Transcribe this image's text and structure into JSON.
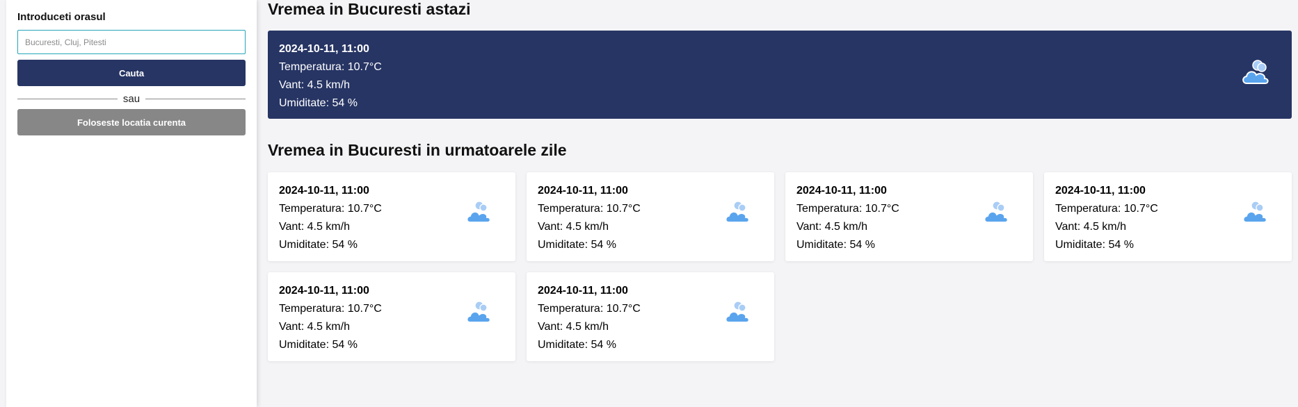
{
  "sidebar": {
    "title": "Introduceti orasul",
    "input_placeholder": "Bucuresti, Cluj, Pitesti",
    "input_value": "",
    "search_label": "Cauta",
    "divider_label": "sau",
    "location_label": "Foloseste locatia curenta"
  },
  "today": {
    "title": "Vremea in Bucuresti astazi",
    "date": "2024-10-11, 11:00",
    "temperature": "Temperatura: 10.7°C",
    "wind": "Vant: 4.5 km/h",
    "humidity": "Umiditate: 54 %",
    "icon": "cloudy-icon"
  },
  "forecast": {
    "title": "Vremea in Bucuresti in urmatoarele zile",
    "items": [
      {
        "date": "2024-10-11, 11:00",
        "temperature": "Temperatura: 10.7°C",
        "wind": "Vant: 4.5 km/h",
        "humidity": "Umiditate: 54 %",
        "icon": "cloudy-icon"
      },
      {
        "date": "2024-10-11, 11:00",
        "temperature": "Temperatura: 10.7°C",
        "wind": "Vant: 4.5 km/h",
        "humidity": "Umiditate: 54 %",
        "icon": "cloudy-icon"
      },
      {
        "date": "2024-10-11, 11:00",
        "temperature": "Temperatura: 10.7°C",
        "wind": "Vant: 4.5 km/h",
        "humidity": "Umiditate: 54 %",
        "icon": "cloudy-icon"
      },
      {
        "date": "2024-10-11, 11:00",
        "temperature": "Temperatura: 10.7°C",
        "wind": "Vant: 4.5 km/h",
        "humidity": "Umiditate: 54 %",
        "icon": "cloudy-icon"
      },
      {
        "date": "2024-10-11, 11:00",
        "temperature": "Temperatura: 10.7°C",
        "wind": "Vant: 4.5 km/h",
        "humidity": "Umiditate: 54 %",
        "icon": "cloudy-icon"
      },
      {
        "date": "2024-10-11, 11:00",
        "temperature": "Temperatura: 10.7°C",
        "wind": "Vant: 4.5 km/h",
        "humidity": "Umiditate: 54 %",
        "icon": "cloudy-icon"
      }
    ]
  },
  "colors": {
    "primary": "#273564",
    "secondary_button": "#878787",
    "input_border": "#23a5b8",
    "cloud": "#5aa4ee",
    "background": "#f4f4f7"
  }
}
